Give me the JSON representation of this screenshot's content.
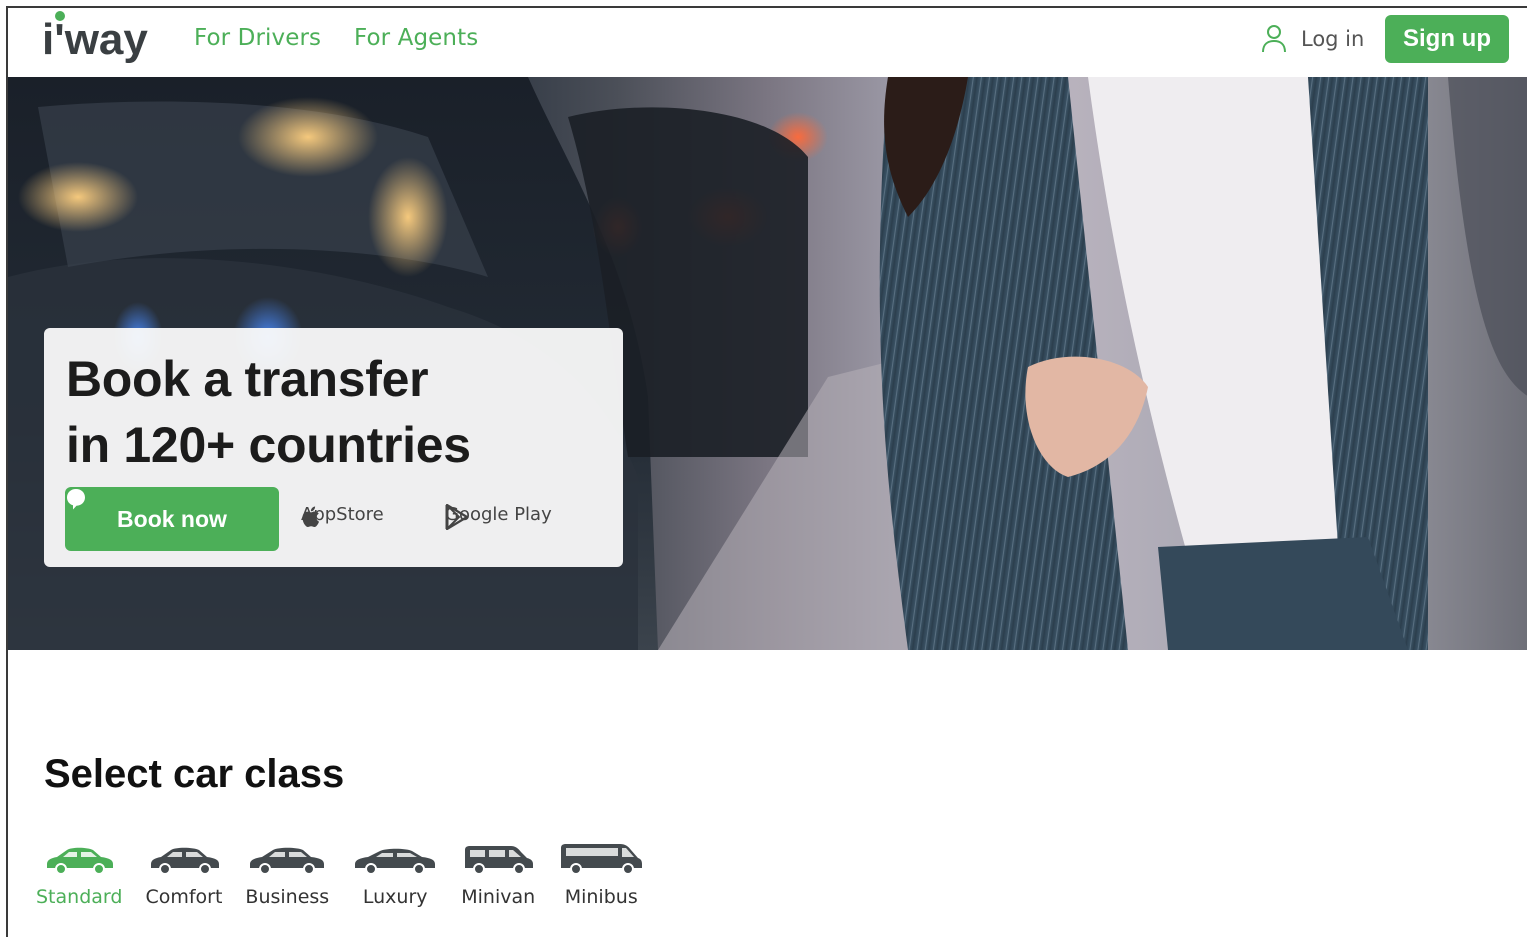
{
  "header": {
    "logo_text": "i'way",
    "nav": [
      {
        "label": "For Drivers"
      },
      {
        "label": "For Agents"
      }
    ],
    "login_label": "Log in",
    "signup_label": "Sign up"
  },
  "hero": {
    "title_line1": "Book a transfer",
    "title_line2": "in 120+ countries",
    "book_label": "Book now",
    "appstore_label": "AppStore",
    "googleplay_label": "Google Play"
  },
  "car_classes": {
    "title": "Select car class",
    "items": [
      {
        "label": "Standard",
        "icon": "sedan-icon",
        "active": true
      },
      {
        "label": "Comfort",
        "icon": "sedan-icon",
        "active": false
      },
      {
        "label": "Business",
        "icon": "sedan-icon",
        "active": false
      },
      {
        "label": "Luxury",
        "icon": "sedan-icon",
        "active": false
      },
      {
        "label": "Minivan",
        "icon": "minivan-icon",
        "active": false
      },
      {
        "label": "Minibus",
        "icon": "minibus-icon",
        "active": false
      }
    ]
  },
  "colors": {
    "brand_green": "#4caf58",
    "text_dark": "#1c1c1c",
    "icon_gray": "#444a4e"
  }
}
